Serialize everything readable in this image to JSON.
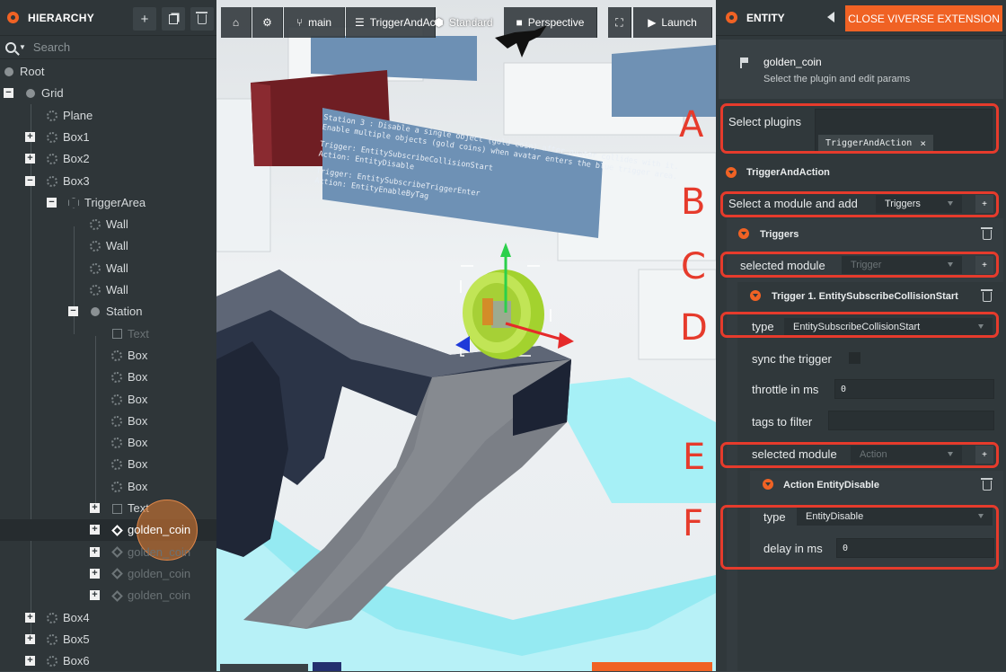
{
  "hierarchy": {
    "title": "HIERARCHY",
    "search_placeholder": "Search",
    "nodes": [
      {
        "label": "Root"
      },
      {
        "label": "Grid"
      },
      {
        "label": "Plane"
      },
      {
        "label": "Box1"
      },
      {
        "label": "Box2"
      },
      {
        "label": "Box3"
      },
      {
        "label": "TriggerArea"
      },
      {
        "label": "Wall"
      },
      {
        "label": "Wall"
      },
      {
        "label": "Wall"
      },
      {
        "label": "Wall"
      },
      {
        "label": "Station"
      },
      {
        "label": "Text"
      },
      {
        "label": "Box"
      },
      {
        "label": "Box"
      },
      {
        "label": "Box"
      },
      {
        "label": "Box"
      },
      {
        "label": "Box"
      },
      {
        "label": "Box"
      },
      {
        "label": "Box"
      },
      {
        "label": "Text"
      },
      {
        "label": "golden_coin"
      },
      {
        "label": "golden_coin"
      },
      {
        "label": "golden_coin"
      },
      {
        "label": "golden_coin"
      },
      {
        "label": "Box4"
      },
      {
        "label": "Box5"
      },
      {
        "label": "Box6"
      }
    ]
  },
  "toolbar": {
    "branch": "main",
    "scene": "TriggerAndAction",
    "shading": "Standard",
    "camera": "Perspective",
    "launch": "Launch"
  },
  "viewport": {
    "panel_lines": [
      "Station 3 : Disable a single object (gold coin) after avatar collides with it.",
      "Enable multiple objects (gold coins) when avatar enters the blue trigger area.",
      "Trigger: EntitySubscribeCollisionStart",
      "Action: EntityDisable",
      "Trigger: EntitySubscribeTriggerEnter",
      "Action: EntityEnableByTag"
    ]
  },
  "entity": {
    "title": "ENTITY",
    "close_button": "CLOSE VIVERSE EXTENSION",
    "name": "golden_coin",
    "subtitle": "Select the plugin and edit params",
    "select_plugins_label": "Select plugins",
    "plugin_chip": "TriggerAndAction",
    "plugin_section": "TriggerAndAction",
    "module_add_label": "Select a module and add",
    "module_add_value": "Triggers",
    "triggers_section": "Triggers",
    "selected_module_label": "selected module",
    "selected_module_trigger": "Trigger",
    "trigger1_title": "Trigger 1. EntitySubscribeCollisionStart",
    "type_label": "type",
    "trigger_type_value": "EntitySubscribeCollisionStart",
    "sync_label": "sync the trigger",
    "throttle_label": "throttle in ms",
    "throttle_value": "0",
    "tags_label": "tags to filter",
    "selected_module_action": "Action",
    "action_title": "Action EntityDisable",
    "action_type_value": "EntityDisable",
    "delay_label": "delay in ms",
    "delay_value": "0"
  },
  "annotations": [
    "A",
    "B",
    "C",
    "D",
    "E",
    "F"
  ],
  "colors": {
    "accent": "#f06224",
    "annotation_red": "#e63b2c",
    "panel_bg": "#30383b"
  }
}
